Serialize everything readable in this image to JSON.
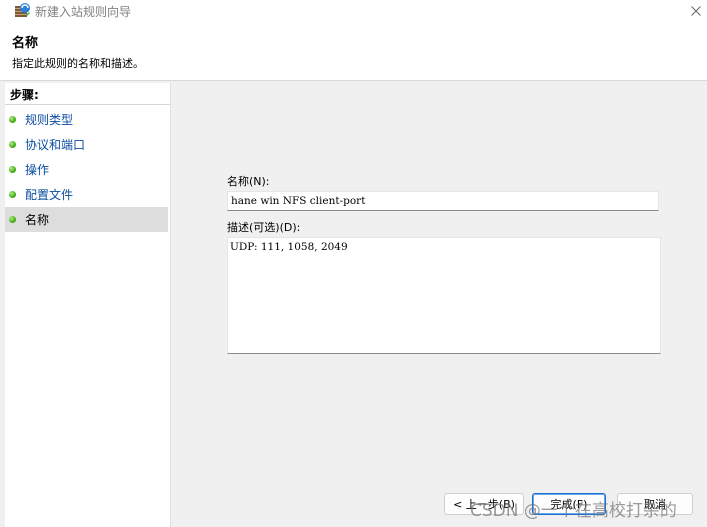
{
  "window": {
    "title": "新建入站规则向导"
  },
  "header": {
    "title": "名称",
    "description": "指定此规则的名称和描述。"
  },
  "steps": {
    "heading": "步骤:",
    "items": [
      {
        "label": "规则类型",
        "active": false
      },
      {
        "label": "协议和端口",
        "active": false
      },
      {
        "label": "操作",
        "active": false
      },
      {
        "label": "配置文件",
        "active": false
      },
      {
        "label": "名称",
        "active": true
      }
    ]
  },
  "form": {
    "name_label": "名称(N):",
    "name_value": "hane win NFS client-port",
    "description_label": "描述(可选)(D):",
    "description_value": "UDP: 111, 1058, 2049"
  },
  "buttons": {
    "back": "< 上一步(B)",
    "finish": "完成(F)",
    "cancel": "取消"
  },
  "watermark": "CSDN @一个在高校打杂的",
  "colors": {
    "step_link": "#0b4da1",
    "active_step_bg": "#dddddd",
    "primary_border": "#1a6fd0",
    "panel_bg": "#f0f0f0"
  },
  "icons": {
    "app": "firewall-wizard-icon",
    "close": "close-icon",
    "step_bullet": "green-dot-icon"
  }
}
